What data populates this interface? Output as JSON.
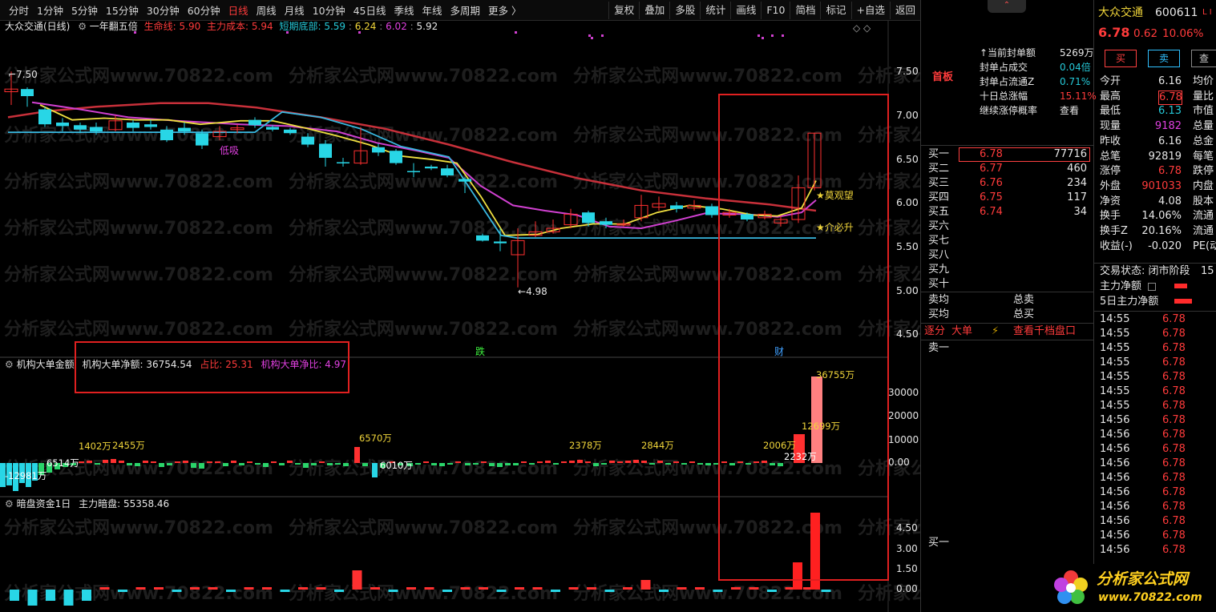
{
  "toolbar": {
    "timeframes": [
      "分时",
      "1分钟",
      "5分钟",
      "15分钟",
      "30分钟",
      "60分钟",
      "日线",
      "周线",
      "月线",
      "10分钟",
      "45日线",
      "季线",
      "年线",
      "多周期",
      "更多 〉"
    ],
    "active_timeframe": "日线",
    "tools": [
      "复权",
      "叠加",
      "多股",
      "统计",
      "画线",
      "F10",
      "简档",
      "标记",
      "+自选",
      "返回"
    ]
  },
  "main_header": {
    "stock": "大众交通(日线)",
    "indicator": "一年翻五倍",
    "life_line": "生命线: 5.90",
    "main_cost": "主力成本: 5.94",
    "short_bottom_label": "短期底部:",
    "v1": "5.59",
    "v2": "6.24",
    "v3": "6.02",
    "v4": "5.92"
  },
  "price_axis": [
    "7.50",
    "7.00",
    "6.50",
    "6.00",
    "5.50",
    "5.00",
    "4.50"
  ],
  "annotations": {
    "high": "7.50",
    "low": "4.98",
    "dixi": "低吸",
    "mo_guan_wang": "★莫观望",
    "jie_bi_sheng": "★介必升",
    "die": "跌",
    "cai": "财"
  },
  "watermark": "分析家公式网www.70822.com",
  "panel2": {
    "title": "机构大单金额",
    "net_label": "机构大单净额:",
    "net_value": "36754.54",
    "ratio": "占比: 25.31",
    "net_ratio": "机构大单净比: 4.97",
    "axis": [
      "30000",
      "20000",
      "10000",
      "0.00"
    ],
    "labels": [
      "36755万",
      "12699万",
      "6570万",
      "6010万",
      "2378万",
      "2844万",
      "2006万",
      "2232万",
      "2455万",
      "1402万",
      "6514万",
      "-12981万"
    ]
  },
  "panel3": {
    "title": "暗盘资金1日",
    "main_label": "主力暗盘:",
    "main_value": "55358.46",
    "axis": [
      "4.50",
      "3.00",
      "1.50",
      "0.00"
    ]
  },
  "quote": {
    "name": "大众交通",
    "code": "600611",
    "price": "6.78",
    "change": "0.62",
    "pct": "10.06%",
    "buy_btn": "买",
    "sell_btn": "卖",
    "board_tag": "首板",
    "seal_info": [
      {
        "label": "当前封单额",
        "value": "5269万",
        "cls": "white"
      },
      {
        "label": "封单占成交",
        "value": "0.04倍",
        "cls": "cyan"
      },
      {
        "label": "封单占流通Z",
        "value": "0.71%",
        "cls": "cyan"
      },
      {
        "label": "十日总涨幅",
        "value": "15.11%",
        "cls": "red"
      },
      {
        "label": "继续涨停概率",
        "value": "查看",
        "cls": "white"
      }
    ],
    "bids": [
      {
        "label": "买一",
        "price": "6.78",
        "vol": "77716"
      },
      {
        "label": "买二",
        "price": "6.77",
        "vol": "460"
      },
      {
        "label": "买三",
        "price": "6.76",
        "vol": "234"
      },
      {
        "label": "买四",
        "price": "6.75",
        "vol": "117"
      },
      {
        "label": "买五",
        "price": "6.74",
        "vol": "34"
      },
      {
        "label": "买六",
        "price": "",
        "vol": ""
      },
      {
        "label": "买七",
        "price": "",
        "vol": ""
      },
      {
        "label": "买八",
        "price": "",
        "vol": ""
      },
      {
        "label": "买九",
        "price": "",
        "vol": ""
      },
      {
        "label": "买十",
        "price": "",
        "vol": ""
      }
    ],
    "sell_avg": "卖均",
    "buy_avg": "买均",
    "total_sell": "总卖",
    "total_buy": "总买",
    "tabs": [
      "逐分",
      "大单"
    ],
    "view_1000": "查看千档盘口",
    "sell1": "卖一",
    "buy1": "买一",
    "stats": [
      {
        "label": "今开",
        "value": "6.16",
        "cls": "white",
        "r": "均价"
      },
      {
        "label": "最高",
        "value": "6.78",
        "cls": "red",
        "r": "量比"
      },
      {
        "label": "最低",
        "value": "6.13",
        "cls": "cyan",
        "r": "市值"
      },
      {
        "label": "现量",
        "value": "9182",
        "cls": "mag",
        "r": "总量"
      },
      {
        "label": "昨收",
        "value": "6.16",
        "cls": "white",
        "r": "总金"
      },
      {
        "label": "总笔",
        "value": "92819",
        "cls": "white",
        "r": "每笔"
      },
      {
        "label": "涨停",
        "value": "6.78",
        "cls": "red",
        "r": "跌停"
      },
      {
        "label": "外盘",
        "value": "901033",
        "cls": "red",
        "r": "内盘"
      },
      {
        "label": "净资",
        "value": "4.08",
        "cls": "white",
        "r": "股本"
      },
      {
        "label": "换手",
        "value": "14.06%",
        "cls": "white",
        "r": "流通"
      },
      {
        "label": "换手Z",
        "value": "20.16%",
        "cls": "white",
        "r": "流通"
      },
      {
        "label": "收益(-)",
        "value": "-0.020",
        "cls": "white",
        "r": "PE(动"
      }
    ],
    "trade_status": "交易状态: 闭市阶段",
    "trade_status_r": "15",
    "main_net": "主力净额",
    "main_net_5d": "5日主力净额",
    "ticks": [
      [
        "14:55",
        "6.78"
      ],
      [
        "14:55",
        "6.78"
      ],
      [
        "14:55",
        "6.78"
      ],
      [
        "14:55",
        "6.78"
      ],
      [
        "14:55",
        "6.78"
      ],
      [
        "14:55",
        "6.78"
      ],
      [
        "14:55",
        "6.78"
      ],
      [
        "14:56",
        "6.78"
      ],
      [
        "14:56",
        "6.78"
      ],
      [
        "14:56",
        "6.78"
      ],
      [
        "14:56",
        "6.78"
      ],
      [
        "14:56",
        "6.78"
      ],
      [
        "14:56",
        "6.78"
      ],
      [
        "14:56",
        "6.78"
      ],
      [
        "14:56",
        "6.78"
      ],
      [
        "14:56",
        "6.78"
      ],
      [
        "14:56",
        "6.78"
      ]
    ]
  },
  "logo": {
    "text": "分析家公式网",
    "url": "www.70822.com"
  },
  "colors": {
    "up": "#ff3030",
    "down": "#28d6e6",
    "ma_red": "#c8303a",
    "ma_mag": "#d040d0",
    "ma_yel": "#f0e040",
    "ma_cyan": "#38b8e0"
  }
}
